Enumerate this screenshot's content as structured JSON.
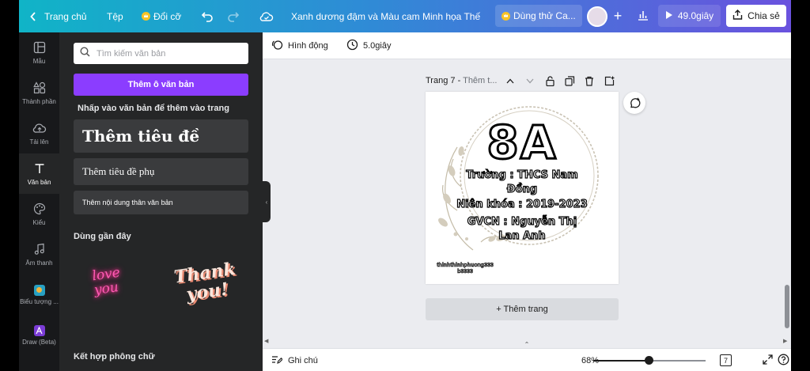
{
  "topbar": {
    "home_label": "Trang chủ",
    "file_label": "Tệp",
    "resize_label": "Đổi cỡ",
    "doc_title": "Xanh dương đậm và Màu cam Minh họa Thế th...",
    "try_label": "Dùng thử Ca...",
    "play_label": "49.0giây",
    "share_label": "Chia sẻ"
  },
  "rail": {
    "items": [
      {
        "label": "Mẫu",
        "icon": "template-icon"
      },
      {
        "label": "Thành phần",
        "icon": "elements-icon"
      },
      {
        "label": "Tải lên",
        "icon": "upload-cloud-icon"
      },
      {
        "label": "Văn bản",
        "icon": "text-icon"
      },
      {
        "label": "Kiểu",
        "icon": "palette-icon"
      },
      {
        "label": "Âm thanh",
        "icon": "music-icon"
      },
      {
        "label": "Biểu tượng ...",
        "icon": "logo-app-icon"
      },
      {
        "label": "Draw (Beta)",
        "icon": "draw-app-icon"
      }
    ],
    "active": "Văn bản"
  },
  "panel": {
    "search_placeholder": "Tìm kiếm văn bản",
    "add_textbox": "Thêm ô văn bản",
    "hint": "Nhấp vào văn bản để thêm vào trang",
    "heading": "Thêm tiêu đề",
    "subheading": "Thêm tiêu đề phụ",
    "body": "Thêm nội dung thân văn bản",
    "recent_title": "Dùng gần đây",
    "recent_love": "love you",
    "recent_thank": "Thank you!",
    "font_combos": "Kết hợp phông chữ"
  },
  "editbar": {
    "animate_label": "Hình động",
    "duration_label": "5.0giây"
  },
  "page": {
    "label": "Trang 7",
    "title_placeholder": "Thêm t...",
    "big": "8A",
    "line1": "Trường : THCS Nam",
    "line2": "Đồng",
    "line3": "Niên khóa : 2019-2023",
    "line4": "GVCN : Nguyễn Thị",
    "line5": "Lan Anh",
    "tiny": "thinhthinhphuong333 b3333"
  },
  "add_page_label": "+ Thêm trang",
  "bottom": {
    "notes_label": "Ghi chú",
    "zoom_label": "68%",
    "zoom_fraction": 0.49,
    "page_count": "7"
  },
  "colors": {
    "accent": "#8b3dff",
    "panel_bg": "#252627",
    "rail_bg": "#18191b",
    "gradient_start": "#10b4c7",
    "gradient_end": "#6a52de"
  }
}
